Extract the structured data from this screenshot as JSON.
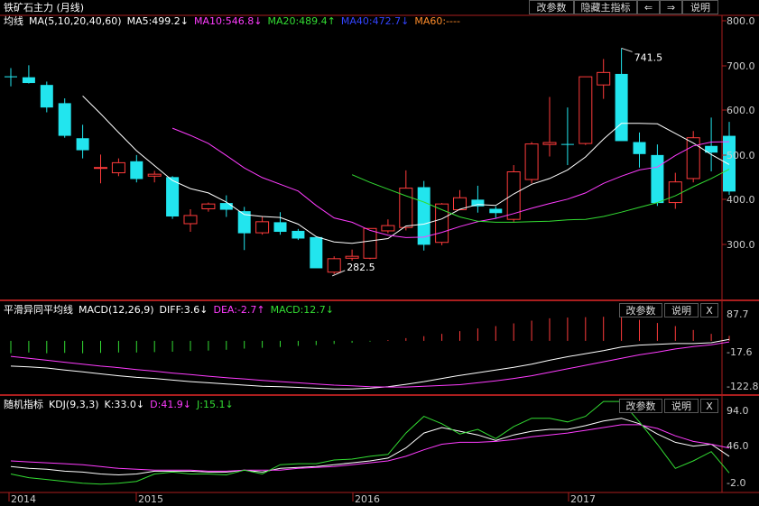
{
  "window": {
    "title": "铁矿石主力 (月线)",
    "buttons": [
      "改参数",
      "隐藏主指标",
      "⇐",
      "⇒",
      "说明"
    ],
    "colors": {
      "background": "#000000",
      "up": "#ff3b3b",
      "down": "#22e5ee",
      "grid_frame": "#aa1e1e"
    }
  },
  "panels": {
    "main": {
      "name": "均线",
      "indicator": "MA(5,10,20,40,60)",
      "legend": [
        {
          "text": "MA5:499.2↓",
          "color": "#ffffff"
        },
        {
          "text": "MA10:546.8↓",
          "color": "#ff3cff"
        },
        {
          "text": "MA20:489.4↑",
          "color": "#33dd33"
        },
        {
          "text": "MA40:472.7↓",
          "color": "#3344ff"
        },
        {
          "text": "MA60:----",
          "color": "#ff8c2a"
        }
      ],
      "y_ticks": [
        "800.0",
        "700.0",
        "600.0",
        "500.0",
        "400.0",
        "300.0"
      ],
      "annotations": {
        "high": "741.5",
        "low": "282.5"
      }
    },
    "macd": {
      "name": "平滑异同平均线",
      "indicator": "MACD(12,26,9)",
      "legend": [
        {
          "text": "DIFF:3.6↓",
          "color": "#ffffff"
        },
        {
          "text": "DEA:-2.7↑",
          "color": "#ff3cff"
        },
        {
          "text": "MACD:12.7↓",
          "color": "#33dd33"
        }
      ],
      "y_ticks": [
        "87.7",
        "-17.6",
        "-122.8"
      ],
      "buttons": [
        "改参数",
        "说明",
        "X"
      ]
    },
    "kdj": {
      "name": "随机指标",
      "indicator": "KDJ(9,3,3)",
      "legend": [
        {
          "text": "K:33.0↓",
          "color": "#ffffff"
        },
        {
          "text": "D:41.9↓",
          "color": "#ff3cff"
        },
        {
          "text": "J:15.1↓",
          "color": "#33dd33"
        }
      ],
      "y_ticks": [
        "94.0",
        "46.0",
        "-2.0"
      ],
      "buttons": [
        "改参数",
        "说明",
        "X"
      ]
    }
  },
  "x_axis": {
    "labels": [
      "2014",
      "2015",
      "2016",
      "2017"
    ]
  },
  "chart_data": {
    "type": "candlestick",
    "title": "铁矿石主力 (月线)",
    "start_month": "2014-01",
    "ylim": [
      220,
      810
    ],
    "candles": [
      [
        683,
        700,
        662,
        681
      ],
      [
        681,
        706,
        668,
        669
      ],
      [
        665,
        672,
        608,
        618
      ],
      [
        627,
        637,
        555,
        559
      ],
      [
        554,
        582,
        512,
        529
      ],
      [
        493,
        520,
        460,
        493
      ],
      [
        482,
        512,
        475,
        503
      ],
      [
        506,
        519,
        462,
        469
      ],
      [
        475,
        486,
        462,
        479
      ],
      [
        473,
        475,
        386,
        391
      ],
      [
        376,
        406,
        359,
        393
      ],
      [
        407,
        420,
        401,
        417
      ],
      [
        419,
        435,
        390,
        405
      ],
      [
        402,
        411,
        321,
        356
      ],
      [
        357,
        390,
        353,
        380
      ],
      [
        379,
        400,
        353,
        359
      ],
      [
        361,
        365,
        342,
        345
      ],
      [
        348,
        349,
        285,
        283
      ],
      [
        275,
        308,
        271,
        303
      ],
      [
        304,
        322,
        299,
        308
      ],
      [
        304,
        363,
        302,
        366
      ],
      [
        361,
        385,
        356,
        372
      ],
      [
        368,
        487,
        362,
        450
      ],
      [
        452,
        465,
        320,
        332
      ],
      [
        337,
        419,
        331,
        417
      ],
      [
        405,
        446,
        404,
        430
      ],
      [
        426,
        455,
        399,
        412
      ],
      [
        407,
        412,
        388,
        398
      ],
      [
        385,
        498,
        380,
        484
      ],
      [
        468,
        546,
        460,
        542
      ],
      [
        541,
        640,
        516,
        545
      ],
      [
        542,
        618,
        498,
        541
      ],
      [
        543,
        656,
        540,
        682
      ],
      [
        665,
        719,
        636,
        691
      ],
      [
        688,
        741.5,
        551,
        548
      ],
      [
        546,
        566,
        493,
        521
      ],
      [
        519,
        541,
        413,
        419
      ],
      [
        420,
        482,
        407,
        463
      ],
      [
        470,
        569,
        462,
        555
      ],
      [
        538,
        597,
        485,
        524
      ],
      [
        559,
        588,
        436,
        443
      ]
    ],
    "ma5": [
      null,
      null,
      null,
      null,
      642,
      605,
      566,
      528,
      497,
      466,
      449,
      440,
      421,
      395,
      391,
      389,
      375,
      349,
      338,
      335,
      340,
      345,
      371,
      375,
      386,
      406,
      416,
      414,
      438,
      458,
      470,
      488,
      515,
      552,
      585,
      585,
      584,
      564,
      544,
      520,
      499.2
    ],
    "ma10": [
      null,
      null,
      null,
      null,
      null,
      null,
      null,
      null,
      null,
      575,
      560,
      543,
      518,
      492,
      472,
      458,
      444,
      414,
      388,
      379,
      362,
      352,
      347,
      348,
      358,
      370,
      380,
      387,
      397,
      408,
      418,
      427,
      440,
      460,
      475,
      488,
      494,
      518,
      538,
      546,
      546.8
    ],
    "ma20": [
      null,
      null,
      null,
      null,
      null,
      null,
      null,
      null,
      null,
      null,
      null,
      null,
      null,
      null,
      null,
      null,
      null,
      null,
      null,
      478,
      462,
      448,
      434,
      421,
      405,
      390,
      381,
      379,
      379,
      380,
      381,
      384,
      385,
      391,
      400,
      410,
      420,
      434,
      453,
      470,
      489.4
    ],
    "ma40": [
      null,
      null,
      null,
      null,
      null,
      null,
      null,
      null,
      null,
      null,
      null,
      null,
      null,
      null,
      null,
      null,
      null,
      null,
      null,
      null,
      null,
      null,
      null,
      null,
      null,
      null,
      null,
      null,
      null,
      null,
      null,
      null,
      null,
      null,
      null,
      null,
      null,
      null,
      null,
      null,
      472.7
    ],
    "macd_panel": {
      "ylim": [
        -135,
        95
      ],
      "diff": [
        -65,
        -67,
        -70,
        -75,
        -80,
        -85,
        -90,
        -94,
        -97,
        -101,
        -105,
        -108,
        -111,
        -114,
        -117,
        -118,
        -120,
        -122,
        -124,
        -124,
        -122,
        -118,
        -112,
        -105,
        -97,
        -89,
        -82,
        -75,
        -68,
        -60,
        -50,
        -41,
        -33,
        -25,
        -16,
        -11,
        -9,
        -7,
        -7,
        -5,
        3.6
      ],
      "dea": [
        -40,
        -45,
        -50,
        -55,
        -60,
        -65,
        -69,
        -74,
        -78,
        -83,
        -87,
        -91,
        -95,
        -98,
        -102,
        -105,
        -108,
        -111,
        -114,
        -116,
        -118,
        -119,
        -119,
        -117,
        -115,
        -113,
        -108,
        -103,
        -97,
        -90,
        -81,
        -72,
        -63,
        -54,
        -45,
        -36,
        -29,
        -21,
        -15,
        -10,
        -2.7
      ],
      "macd": [
        -32,
        -30,
        -32,
        -31,
        -32,
        -31,
        -30,
        -30,
        -29,
        -28,
        -26,
        -25,
        -23,
        -20,
        -18,
        -16,
        -13,
        -11,
        -8,
        -5,
        -2,
        2,
        7,
        12,
        18,
        25,
        32,
        38,
        45,
        52,
        58,
        60,
        61,
        62,
        63,
        54,
        46,
        38,
        28,
        18,
        12.7
      ]
    },
    "kdj_panel": {
      "ylim": [
        -4,
        96
      ],
      "k": [
        22,
        20,
        19,
        17,
        16,
        14,
        13,
        14,
        17,
        17,
        17,
        16,
        16,
        18,
        16,
        20,
        21,
        22,
        24,
        26,
        28,
        31,
        42,
        58,
        64,
        60,
        56,
        50,
        56,
        60,
        62,
        62,
        66,
        71,
        74,
        68,
        57,
        48,
        44,
        46,
        33.0
      ],
      "d": [
        28,
        27,
        26,
        25,
        24,
        22,
        20,
        19,
        18,
        18,
        18,
        17,
        17,
        18,
        18,
        18,
        20,
        21,
        22,
        24,
        26,
        28,
        33,
        40,
        46,
        48,
        48,
        49,
        51,
        54,
        56,
        58,
        61,
        64,
        67,
        67,
        63,
        55,
        49,
        46,
        41.9
      ],
      "j": [
        14,
        10,
        8,
        6,
        4,
        3,
        4,
        6,
        14,
        16,
        14,
        14,
        13,
        18,
        14,
        24,
        25,
        25,
        29,
        30,
        33,
        35,
        58,
        76,
        68,
        57,
        62,
        52,
        65,
        74,
        74,
        70,
        76,
        92,
        92,
        70,
        46,
        20,
        28,
        38,
        15.1
      ]
    }
  }
}
